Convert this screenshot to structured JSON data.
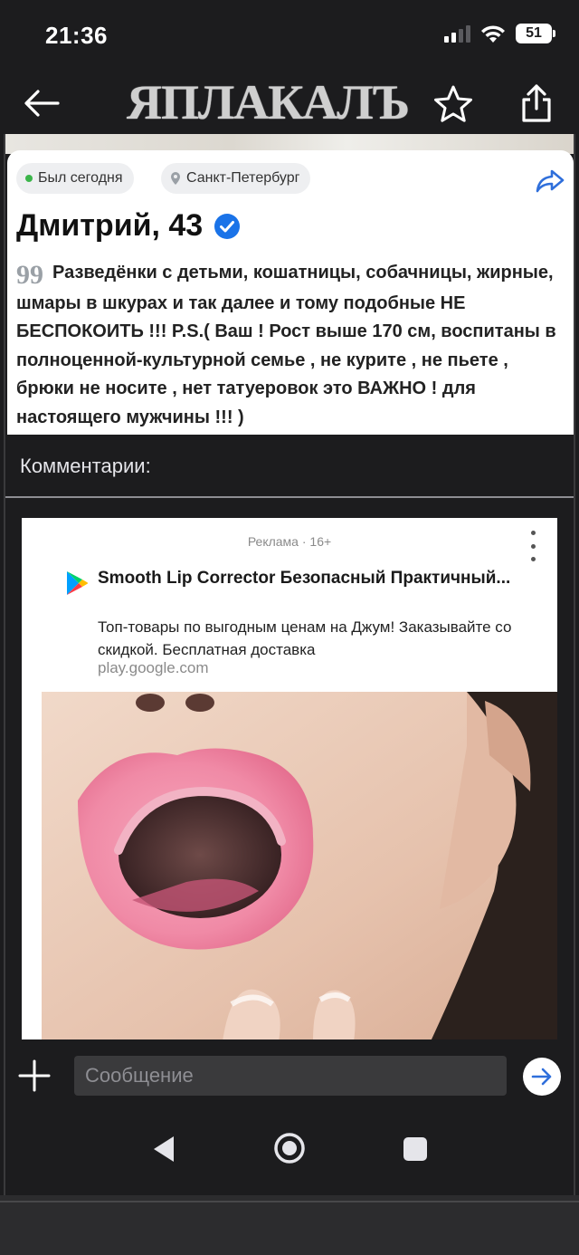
{
  "status_bar": {
    "time": "21:36",
    "battery": "51",
    "icons": [
      "signal-icon",
      "wifi-icon",
      "battery-icon"
    ]
  },
  "header": {
    "logo": "ЯПЛАКАЛЪ",
    "icons": [
      "arrow-left-icon",
      "star-icon",
      "share-icon"
    ]
  },
  "profile": {
    "online_status": "Был сегодня",
    "city": "Санкт-Петербург",
    "name": "Дмитрий, 43",
    "quote_mark": "99",
    "about": "Разведёнки с детьми, кошатницы, собачницы, жирные, шмары в шкурах и так далее и тому подобные НЕ БЕСПОКОИТЬ !!! P.S.( Ваш ! Рост выше 170 см, воспитаны в полноценной-культурной семье , не курите , не пьете , брюки не носите , нет татуеровок это ВАЖНО ! для настоящего мужчины !!! )",
    "colors": {
      "online_dot": "#3bb54a",
      "verified": "#1a73e8",
      "share_arrow": "#2f6fdb"
    }
  },
  "comments": {
    "heading": "Комментарии:"
  },
  "ad": {
    "label": "Реклама · 16+",
    "title": "Smooth Lip Corrector Безопасный Практичный...",
    "description": "Топ-товары по выгодным ценам на Джум! Заказывайте со скидкой. Бесплатная доставка",
    "domain": "play.google.com",
    "image_subject": "woman-face-lip-corrector-photo"
  },
  "composer": {
    "placeholder": "Сообщение"
  },
  "nav": {
    "icons": [
      "nav-back-icon",
      "nav-home-icon",
      "nav-recent-icon"
    ]
  }
}
